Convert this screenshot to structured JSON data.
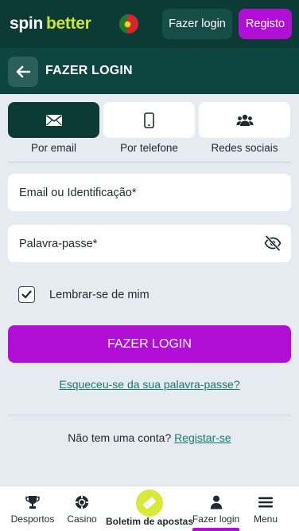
{
  "header": {
    "logo_part1": "spin",
    "logo_part2": "better",
    "language_flag": "portugal-flag",
    "login_label": "Fazer login",
    "register_label": "Registo"
  },
  "subheader": {
    "title": "FAZER LOGIN",
    "back_icon": "arrow-left-icon"
  },
  "methods": [
    {
      "label": "Por email",
      "icon": "envelope-icon",
      "active": true
    },
    {
      "label": "Por telefone",
      "icon": "phone-icon",
      "active": false
    },
    {
      "label": "Redes sociais",
      "icon": "users-icon",
      "active": false
    }
  ],
  "form": {
    "email_label": "Email ou Identificação*",
    "password_label": "Palavra-passe*",
    "password_toggle_icon": "eye-slash-icon",
    "remember_label": "Lembrar-se de mim",
    "remember_checked": true,
    "submit_label": "FAZER LOGIN",
    "forgot_label": "Esqueceu-se da sua palavra-passe?",
    "no_account_text": "Não tem uma conta?",
    "register_link": "Registar-se"
  },
  "bottom_nav": {
    "items": [
      {
        "label": "Desportos",
        "icon": "trophy-icon"
      },
      {
        "label": "Casino",
        "icon": "chip-icon"
      },
      {
        "label": "Boletim de apostas",
        "icon": "ticket-icon"
      },
      {
        "label": "Fazer login",
        "icon": "user-icon",
        "active": true
      },
      {
        "label": "Menu",
        "icon": "hamburger-icon"
      }
    ]
  },
  "colors": {
    "header_bg": "#0c3a35",
    "accent_purple": "#b10fd6",
    "accent_lime": "#cde23a",
    "link_teal": "#1a7a6a",
    "page_bg": "#e6ebf1"
  }
}
